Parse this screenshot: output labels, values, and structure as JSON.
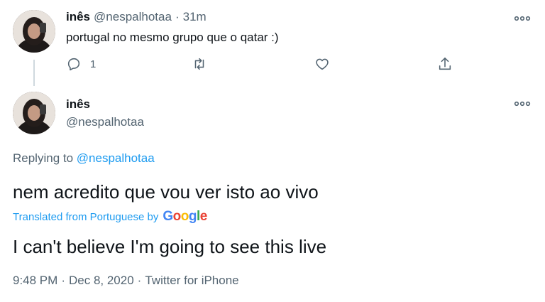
{
  "parent_tweet": {
    "display_name": "inês",
    "handle": "@nespalhotaa",
    "separator": "·",
    "time_ago": "31m",
    "text": "portugal no mesmo grupo que o qatar :)",
    "reply_count": "1",
    "icons": [
      "reply-icon",
      "retweet-icon",
      "like-icon",
      "share-icon",
      "more-icon"
    ]
  },
  "main_tweet": {
    "display_name": "inês",
    "handle": "@nespalhotaa",
    "replying_prefix": "Replying to",
    "replying_handle": "@nespalhotaa",
    "text": "nem acredito que vou ver isto ao vivo",
    "translated_label": "Translated from Portuguese by",
    "translator": "Google",
    "translation": "I can't believe I'm going to see this live",
    "time": "9:48 PM",
    "date": "Dec 8, 2020",
    "source": "Twitter for iPhone",
    "dot": "·"
  },
  "colors": {
    "accent": "#1d9bf0",
    "text": "#0f1419",
    "muted": "#536471",
    "google_blue": "#4285f4",
    "google_red": "#ea4335",
    "google_yellow": "#fbbc05",
    "google_green": "#34a853"
  }
}
